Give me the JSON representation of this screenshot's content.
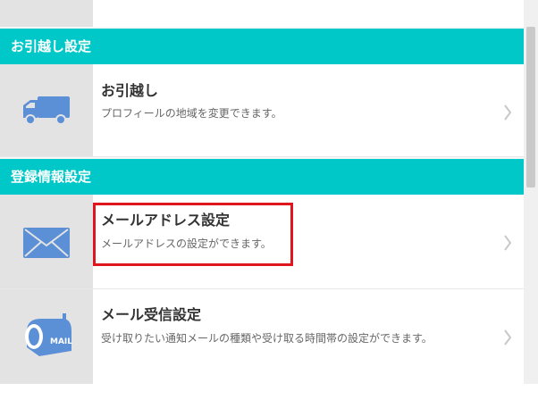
{
  "sections": [
    {
      "header": "お引越し設定",
      "item": {
        "title": "お引越し",
        "description": "プロフィールの地域を変更できます。",
        "icon": "truck-icon"
      }
    },
    {
      "header": "登録情報設定",
      "items": [
        {
          "title": "メールアドレス設定",
          "description": "メールアドレスの設定ができます。",
          "icon": "envelope-icon"
        },
        {
          "title": "メール受信設定",
          "description": "受け取りたい通知メールの種類や受け取る時間帯の設定ができます。",
          "icon": "mailbox-icon",
          "icon_label": "MAIL"
        }
      ]
    }
  ],
  "colors": {
    "header_bg": "#00c8c8",
    "icon_blue": "#5b8fd6",
    "highlight": "#e0161e"
  }
}
